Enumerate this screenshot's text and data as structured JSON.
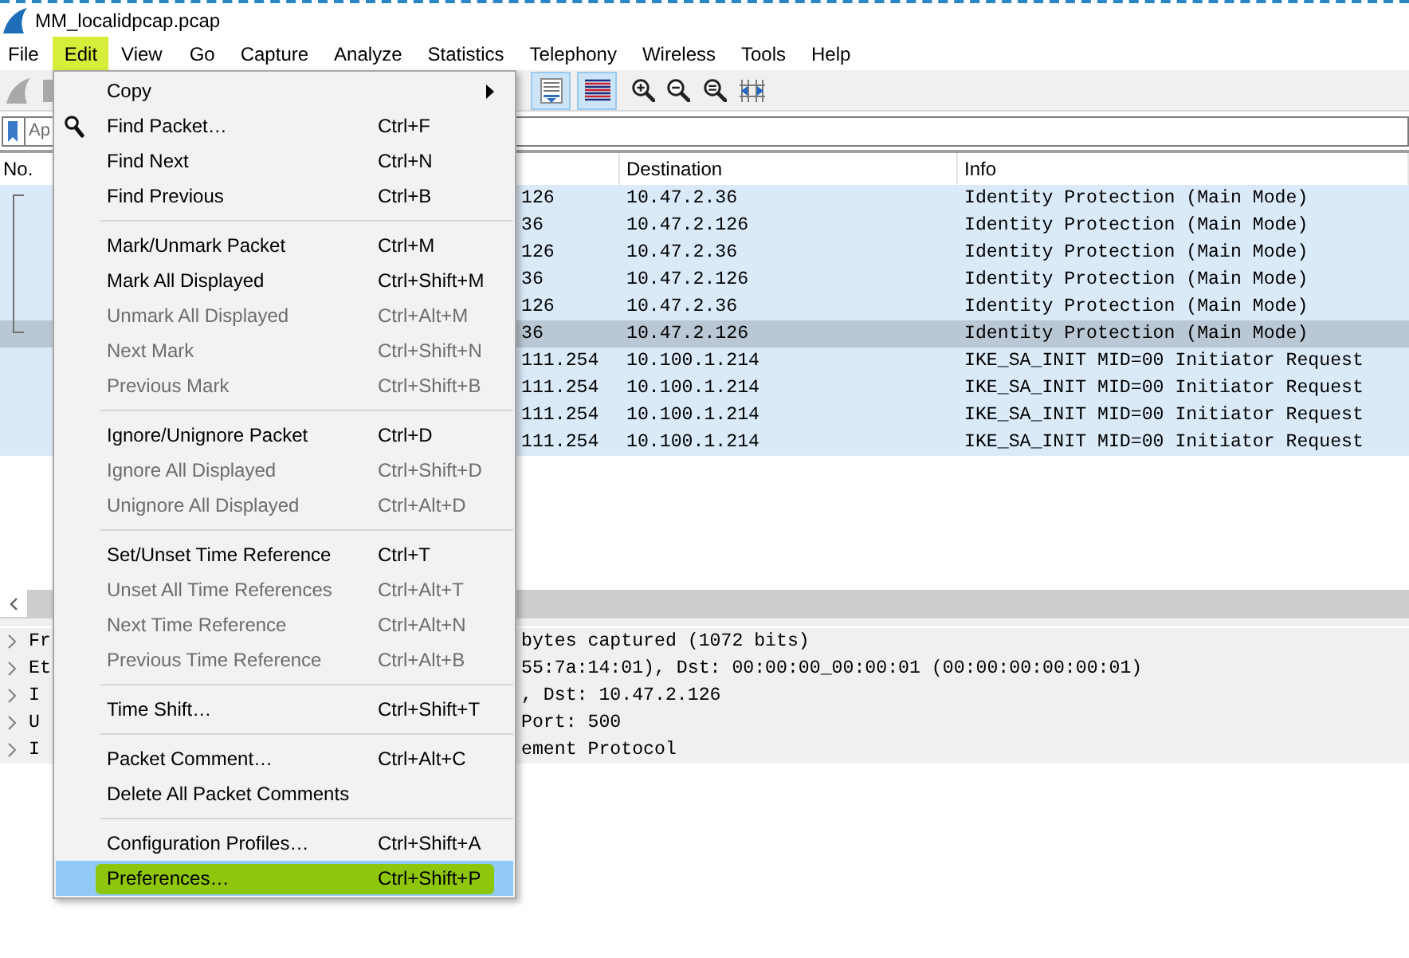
{
  "window": {
    "title": "MM_localidpcap.pcap"
  },
  "menubar": [
    {
      "label": "File",
      "highlighted": false
    },
    {
      "label": "Edit",
      "highlighted": true
    },
    {
      "label": "View",
      "highlighted": false
    },
    {
      "label": "Go",
      "highlighted": false
    },
    {
      "label": "Capture",
      "highlighted": false
    },
    {
      "label": "Analyze",
      "highlighted": false
    },
    {
      "label": "Statistics",
      "highlighted": false
    },
    {
      "label": "Telephony",
      "highlighted": false
    },
    {
      "label": "Wireless",
      "highlighted": false
    },
    {
      "label": "Tools",
      "highlighted": false
    },
    {
      "label": "Help",
      "highlighted": false
    }
  ],
  "toolbar": {
    "toggles": [
      {
        "on": true
      },
      {
        "on": true
      }
    ]
  },
  "filter_bar": {
    "placeholder": "Ap"
  },
  "packet_list": {
    "columns": [
      {
        "label": "No."
      },
      {
        "label": "Destination"
      },
      {
        "label": "Info"
      }
    ],
    "rows": [
      {
        "column_2": "126",
        "destination": "10.47.2.36",
        "info": "Identity Protection (Main Mode)",
        "related": true,
        "selected": false
      },
      {
        "column_2": "36",
        "destination": "10.47.2.126",
        "info": "Identity Protection (Main Mode)",
        "related": true,
        "selected": false
      },
      {
        "column_2": "126",
        "destination": "10.47.2.36",
        "info": "Identity Protection (Main Mode)",
        "related": true,
        "selected": false
      },
      {
        "column_2": "36",
        "destination": "10.47.2.126",
        "info": "Identity Protection (Main Mode)",
        "related": true,
        "selected": false
      },
      {
        "column_2": "126",
        "destination": "10.47.2.36",
        "info": "Identity Protection (Main Mode)",
        "related": true,
        "selected": false
      },
      {
        "column_2": "36",
        "destination": "10.47.2.126",
        "info": "Identity Protection (Main Mode)",
        "related": true,
        "selected": true
      },
      {
        "column_2": "111.254",
        "destination": "10.100.1.214",
        "info": "IKE_SA_INIT MID=00 Initiator Request",
        "related": false,
        "selected": false
      },
      {
        "column_2": "111.254",
        "destination": "10.100.1.214",
        "info": "IKE_SA_INIT MID=00 Initiator Request",
        "related": false,
        "selected": false
      },
      {
        "column_2": "111.254",
        "destination": "10.100.1.214",
        "info": "IKE_SA_INIT MID=00 Initiator Request",
        "related": false,
        "selected": false
      },
      {
        "column_2": "111.254",
        "destination": "10.100.1.214",
        "info": "IKE_SA_INIT MID=00 Initiator Request",
        "related": false,
        "selected": false
      }
    ]
  },
  "details": [
    {
      "start": "Fr",
      "end": "bytes captured (1072 bits)",
      "expanded": false
    },
    {
      "start": "Et",
      "end": "55:7a:14:01), Dst: 00:00:00_00:00:01 (00:00:00:00:00:01)",
      "expanded": false
    },
    {
      "start": "I",
      "end": ", Dst: 10.47.2.126",
      "expanded": false
    },
    {
      "start": "U",
      "end": "Port: 500",
      "expanded": false
    },
    {
      "start": "I",
      "end": "ement Protocol",
      "expanded": false
    }
  ],
  "edit_menu": {
    "items": [
      {
        "kind": "item",
        "label": "Copy",
        "submenu": true,
        "disabled": false,
        "selected": false,
        "highlighted": false
      },
      {
        "kind": "item",
        "label": "Find Packet…",
        "shortcut": "Ctrl+F",
        "icon": true,
        "disabled": false,
        "selected": false,
        "highlighted": false
      },
      {
        "kind": "item",
        "label": "Find Next",
        "shortcut": "Ctrl+N",
        "disabled": false,
        "selected": false,
        "highlighted": false
      },
      {
        "kind": "item",
        "label": "Find Previous",
        "shortcut": "Ctrl+B",
        "disabled": false,
        "selected": false,
        "highlighted": false
      },
      {
        "kind": "separator"
      },
      {
        "kind": "item",
        "label": "Mark/Unmark Packet",
        "shortcut": "Ctrl+M",
        "disabled": false,
        "selected": false,
        "highlighted": false
      },
      {
        "kind": "item",
        "label": "Mark All Displayed",
        "shortcut": "Ctrl+Shift+M",
        "disabled": false,
        "selected": false,
        "highlighted": false
      },
      {
        "kind": "item",
        "label": "Unmark All Displayed",
        "shortcut": "Ctrl+Alt+M",
        "disabled": true,
        "selected": false,
        "highlighted": false
      },
      {
        "kind": "item",
        "label": "Next Mark",
        "shortcut": "Ctrl+Shift+N",
        "disabled": true,
        "selected": false,
        "highlighted": false
      },
      {
        "kind": "item",
        "label": "Previous Mark",
        "shortcut": "Ctrl+Shift+B",
        "disabled": true,
        "selected": false,
        "highlighted": false
      },
      {
        "kind": "separator"
      },
      {
        "kind": "item",
        "label": "Ignore/Unignore Packet",
        "shortcut": "Ctrl+D",
        "disabled": false,
        "selected": false,
        "highlighted": false
      },
      {
        "kind": "item",
        "label": "Ignore All Displayed",
        "shortcut": "Ctrl+Shift+D",
        "disabled": true,
        "selected": false,
        "highlighted": false
      },
      {
        "kind": "item",
        "label": "Unignore All Displayed",
        "shortcut": "Ctrl+Alt+D",
        "disabled": true,
        "selected": false,
        "highlighted": false
      },
      {
        "kind": "separator"
      },
      {
        "kind": "item",
        "label": "Set/Unset Time Reference",
        "shortcut": "Ctrl+T",
        "disabled": false,
        "selected": false,
        "highlighted": false
      },
      {
        "kind": "item",
        "label": "Unset All Time References",
        "shortcut": "Ctrl+Alt+T",
        "disabled": true,
        "selected": false,
        "highlighted": false
      },
      {
        "kind": "item",
        "label": "Next Time Reference",
        "shortcut": "Ctrl+Alt+N",
        "disabled": true,
        "selected": false,
        "highlighted": false
      },
      {
        "kind": "item",
        "label": "Previous Time Reference",
        "shortcut": "Ctrl+Alt+B",
        "disabled": true,
        "selected": false,
        "highlighted": false
      },
      {
        "kind": "separator"
      },
      {
        "kind": "item",
        "label": "Time Shift…",
        "shortcut": "Ctrl+Shift+T",
        "disabled": false,
        "selected": false,
        "highlighted": false
      },
      {
        "kind": "separator"
      },
      {
        "kind": "item",
        "label": "Packet Comment…",
        "shortcut": "Ctrl+Alt+C",
        "disabled": false,
        "selected": false,
        "highlighted": false
      },
      {
        "kind": "item",
        "label": "Delete All Packet Comments",
        "disabled": false,
        "selected": false,
        "highlighted": false
      },
      {
        "kind": "separator"
      },
      {
        "kind": "item",
        "label": "Configuration Profiles…",
        "shortcut": "Ctrl+Shift+A",
        "disabled": false,
        "selected": false,
        "highlighted": false
      },
      {
        "kind": "item",
        "label": "Preferences…",
        "shortcut": "Ctrl+Shift+P",
        "disabled": false,
        "selected": true,
        "highlighted": true
      }
    ]
  }
}
